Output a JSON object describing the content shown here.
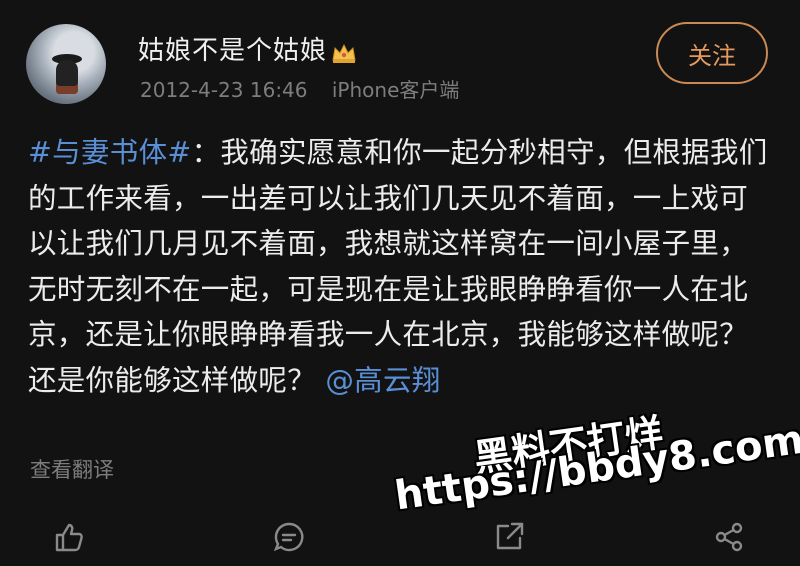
{
  "post": {
    "username": "姑娘不是个姑娘",
    "badge_icon": "crown-icon",
    "timestamp": "2012-4-23 16:46",
    "source": "iPhone客户端",
    "follow_label": "关注",
    "topic": "#与妻书体#",
    "body_text": "：我确实愿意和你一起分秒相守，但根据我们的工作来看，一出差可以让我们几天见不着面，一上戏可以让我们几月见不着面，我想就这样窝在一间小屋子里，无时无刻不在一起，可是现在是让我眼睁睁看你一人在北京，还是让你眼睁睁看我一人在北京，我能够这样做呢？还是你能够这样做呢？",
    "mention": "@高云翔",
    "translate_label": "查看翻译"
  },
  "watermark": {
    "line1": "黑料不打烊",
    "line2": "https://bbdy8.com"
  },
  "toolbar": {
    "icons": [
      "like-icon",
      "comment-icon",
      "repost-icon",
      "share-icon"
    ]
  },
  "colors": {
    "background": "#121212",
    "link": "#5a8fd6",
    "follow_accent": "#e39a5e"
  }
}
